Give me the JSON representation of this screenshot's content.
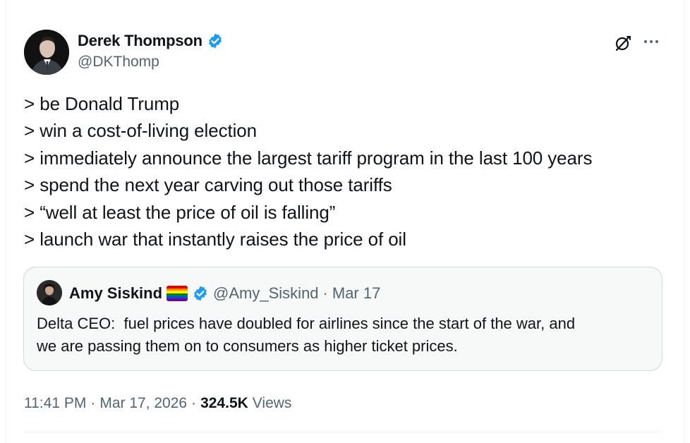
{
  "author": {
    "display_name": "Derek Thompson",
    "handle": "@DKThomp",
    "verified": true
  },
  "icons": {
    "verified": "verified-badge-icon",
    "grok": "grok-icon",
    "more": "more-options-icon",
    "flag": "rainbow-flag-icon"
  },
  "colors": {
    "verified_blue": "#1d9bf0",
    "secondary_text": "#536471",
    "primary_text": "#0f1419",
    "quote_border": "#cfd9de"
  },
  "tweet": {
    "lines": [
      "> be Donald Trump",
      "> win a cost-of-living election",
      "> immediately announce the largest tariff program in the last 100 years",
      "> spend the next year carving out those tariffs",
      "> “well at least the price of oil is falling”",
      "> launch war that instantly raises the price of oil"
    ]
  },
  "quote": {
    "display_name": "Amy Siskind",
    "flag_emoji": "🏳️‍🌈",
    "handle": "@Amy_Siskind",
    "separator": "·",
    "date": "Mar 17",
    "text": "Delta CEO:  fuel prices have doubled for airlines since the start of the war, and\nwe are passing them on to consumers as higher ticket prices."
  },
  "meta": {
    "time": "11:41 PM",
    "separator": "·",
    "date": "Mar 17, 2026",
    "views_count": "324.5K",
    "views_label": "Views"
  }
}
